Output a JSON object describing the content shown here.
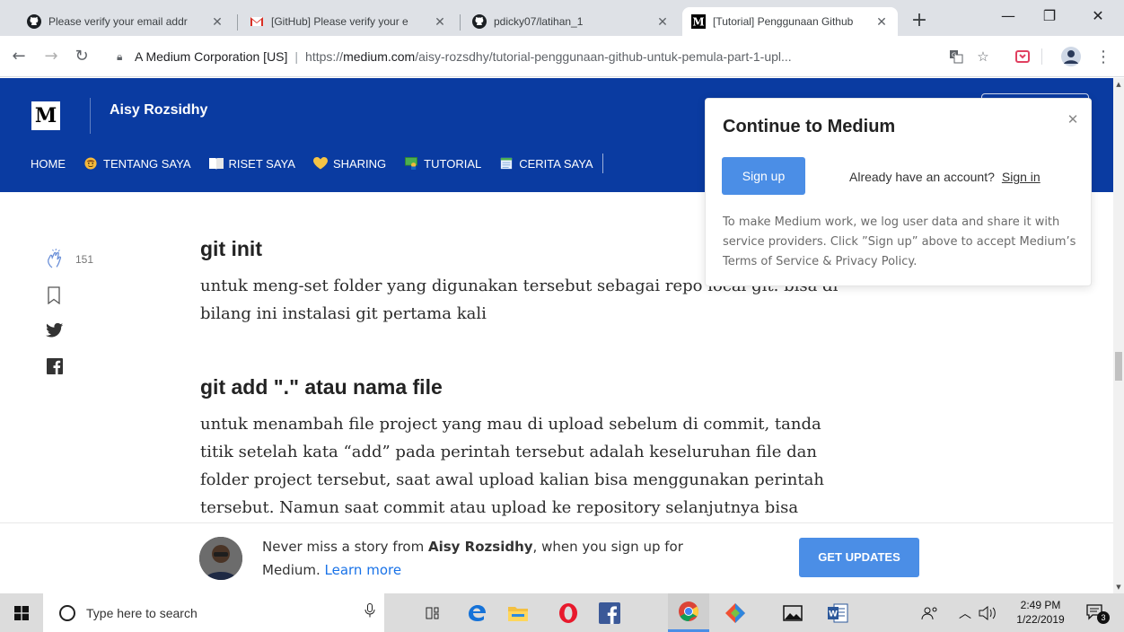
{
  "browser": {
    "tabs": [
      {
        "title": "Please verify your email addr",
        "icon": "github-icon"
      },
      {
        "title": "[GitHub] Please verify your e",
        "icon": "gmail-icon"
      },
      {
        "title": "pdicky07/latihan_1",
        "icon": "github-icon"
      },
      {
        "title": "[Tutorial] Penggunaan Github",
        "icon": "medium-icon",
        "active": true
      }
    ],
    "new_tab": "+",
    "window_controls": {
      "minimize": "—",
      "maximize": "❐",
      "close": "✕"
    },
    "address": {
      "site_identity": "A Medium Corporation [US]",
      "url_scheme": "https://",
      "url_host": "medium.com",
      "url_path": "/aisy-rozsdhy/tutorial-penggunaan-github-untuk-pemula-part-1-upl..."
    }
  },
  "publication": {
    "logo_letter": "M",
    "author": "Aisy Rozsidhy",
    "nav": [
      {
        "label": "HOME",
        "emoji": ""
      },
      {
        "label": "TENTANG SAYA",
        "emoji": "face"
      },
      {
        "label": "RISET SAYA",
        "emoji": "book"
      },
      {
        "label": "SHARING",
        "emoji": "heart"
      },
      {
        "label": "TUTORIAL",
        "emoji": "teacher"
      },
      {
        "label": "CERITA SAYA",
        "emoji": "notebook"
      }
    ]
  },
  "share_rail": {
    "clap_count": "151"
  },
  "article": {
    "heading1": "git init",
    "para1": [
      "untuk meng-set folder yang digunakan tersebut sebagai repo local git. bisa di",
      "bilang ini instalasi git pertama kali"
    ],
    "heading2": "git add \".\" atau nama file",
    "para2": [
      "untuk menambah file project yang mau di upload sebelum di commit, tanda",
      "titik setelah kata “add” pada perintah tersebut adalah keseluruhan file dan",
      "folder project tersebut, saat awal upload kalian bisa menggunakan perintah",
      "tersebut. Namun saat commit atau upload ke repository selanjutnya bisa"
    ]
  },
  "popup": {
    "title": "Continue to Medium",
    "signup_label": "Sign up",
    "already_text": "Already have an account?",
    "signin_label": "Sign in",
    "note": "To make Medium work, we log user data and share it with service providers. Click ”Sign up” above to accept Medium’s Terms of Service & Privacy Policy."
  },
  "promo": {
    "text_before": "Never miss a story from ",
    "author": "Aisy Rozsidhy",
    "text_after": ", when you sign up for",
    "text_line2": "Medium. ",
    "learn_more": "Learn more",
    "button_label": "GET UPDATES"
  },
  "taskbar": {
    "search_placeholder": "Type here to search",
    "time": "2:49 PM",
    "date": "1/22/2019",
    "notification_count": "3"
  },
  "colors": {
    "medium_header": "#0a3ba1",
    "button_blue": "#4b8ee6",
    "link_blue": "#1a73e8"
  }
}
